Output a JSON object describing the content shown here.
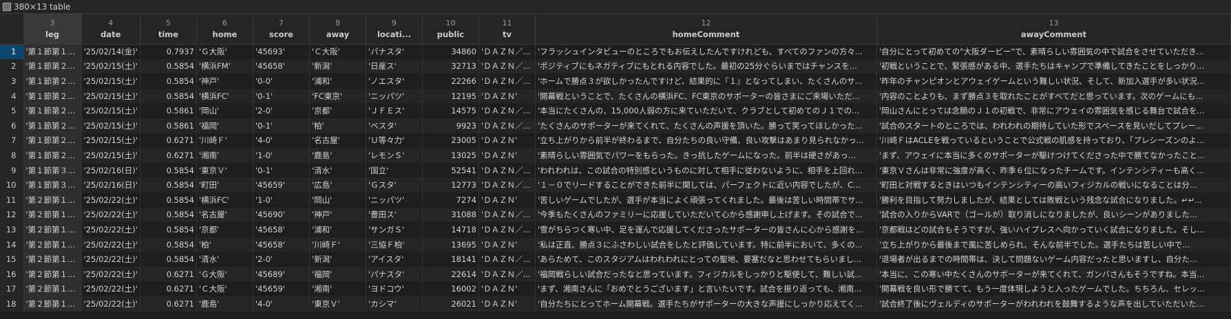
{
  "title": "380×13 table",
  "columns": [
    {
      "num": "3",
      "name": "leg"
    },
    {
      "num": "4",
      "name": "date"
    },
    {
      "num": "5",
      "name": "time"
    },
    {
      "num": "6",
      "name": "home"
    },
    {
      "num": "7",
      "name": "score"
    },
    {
      "num": "8",
      "name": "away"
    },
    {
      "num": "9",
      "name": "locati..."
    },
    {
      "num": "10",
      "name": "public"
    },
    {
      "num": "11",
      "name": "tv"
    },
    {
      "num": "12",
      "name": "homeComment"
    },
    {
      "num": "13",
      "name": "awayComment"
    }
  ],
  "rows": [
    {
      "n": "1",
      "leg": "'第１節第１...",
      "date": "'25/02/14(金)'",
      "time": "0.7937",
      "home": "'Ｇ大阪'",
      "score": "'45693'",
      "away": "'Ｃ大阪'",
      "loc": "'パナスタ'",
      "public": "34860",
      "tv": "'ＤＡＺＮ／...",
      "hc": "'フラッシュインタビューのところでもお伝えしたんですけれども、すべてのファンの方々...",
      "ac": "'自分にとって初めての\"大阪ダービー\"で、素晴らしい雰囲気の中で試合をさせていただき..."
    },
    {
      "n": "2",
      "leg": "'第１節第２...",
      "date": "'25/02/15(土)'",
      "time": "0.5854",
      "home": "'横浜FM'",
      "score": "'45658'",
      "away": "'新潟'",
      "loc": "'日産ス'",
      "public": "32713",
      "tv": "'ＤＡＺＮ／...",
      "hc": "'ポジティブにもネガティブにもとれる内容でした。最初の25分ぐらいまではチャンスを...",
      "ac": "'初戦ということで、緊張感がある中、選手たちはキャンプで準備してきたことをしっかり..."
    },
    {
      "n": "3",
      "leg": "'第１節第２...",
      "date": "'25/02/15(土)'",
      "time": "0.5854",
      "home": "'神戸'",
      "score": "'0-0'",
      "away": "'浦和'",
      "loc": "'ノエスタ'",
      "public": "22266",
      "tv": "'ＤＡＺＮ／...",
      "hc": "'ホームで勝点３が欲しかったんですけど、結果的に『１』となってしまい、たくさんのサ...",
      "ac": "'昨年のチャンピオンとアウェイゲームという難しい状況、そして、新加入選手が多い状況..."
    },
    {
      "n": "4",
      "leg": "'第１節第２...",
      "date": "'25/02/15(土)'",
      "time": "0.5854",
      "home": "'横浜FC'",
      "score": "'0-1'",
      "away": "'FC東京'",
      "loc": "'ニッパツ'",
      "public": "12195",
      "tv": "'ＤＡＺＮ'",
      "hc": "'開幕戦ということで、たくさんの横浜FC、FC東京のサポーターの皆さまにご来場いただ...",
      "ac": "'内容のことよりも、まず勝点３を取れたことがすべてだと思っています。次のゲームにも..."
    },
    {
      "n": "5",
      "leg": "'第１節第２...",
      "date": "'25/02/15(土)'",
      "time": "0.5861",
      "home": "'岡山'",
      "score": "'2-0'",
      "away": "'京都'",
      "loc": "'ＪＦＥス'",
      "public": "14575",
      "tv": "'ＤＡＺＮ／...",
      "hc": "'本当にたくさんの、15,000人弱の方に来ていただいて、クラブとして初めてのＪ１での...",
      "ac": "'岡山さんにとっては念願のＪ１の初戦で、非常にアウェイの雰囲気を感じる舞台で試合を..."
    },
    {
      "n": "6",
      "leg": "'第１節第２...",
      "date": "'25/02/15(土)'",
      "time": "0.5861",
      "home": "'福岡'",
      "score": "'0-1'",
      "away": "'柏'",
      "loc": "'ベスタ'",
      "public": "9923",
      "tv": "'ＤＡＺＮ／...",
      "hc": "'たくさんのサポーターが来てくれて、たくさんの声援を頂いた。勝って笑ってほしかった...",
      "ac": "'試合のスタートのところでは、われわれの期待していた形でスペースを見いだしてプレー..."
    },
    {
      "n": "7",
      "leg": "'第１節第２...",
      "date": "'25/02/15(土)'",
      "time": "0.6271",
      "home": "'川崎Ｆ'",
      "score": "'4-0'",
      "away": "'名古屋'",
      "loc": "'Ｕ等々力'",
      "public": "23005",
      "tv": "'ＤＡＺＮ'",
      "hc": "'立ち上がりから前半が終わるまで、自分たちの良い守備、良い攻撃はあまり見られなかっ...",
      "ac": "'川崎ＦはACLEを戦っているということで公式戦の肌感を持っており、「プレシーズンのよ..."
    },
    {
      "n": "8",
      "leg": "'第１節第２...",
      "date": "'25/02/15(土)'",
      "time": "0.6271",
      "home": "'湘南'",
      "score": "'1-0'",
      "away": "'鹿島'",
      "loc": "'レモンＳ'",
      "public": "13025",
      "tv": "'ＤＡＺＮ'",
      "hc": "'素晴らしい雰囲気でパワーをもらった。きっ抗したゲームになった。前半は硬さがあっ...",
      "ac": "'まず、アウェイに本当に多くのサポーターが駆けつけてくださった中で勝てなかったこと..."
    },
    {
      "n": "9",
      "leg": "'第１節第３...",
      "date": "'25/02/16(日)'",
      "time": "0.5854",
      "home": "'東京Ｖ'",
      "score": "'0-1'",
      "away": "'清水'",
      "loc": "'国立'",
      "public": "52541",
      "tv": "'ＤＡＺＮ／...",
      "hc": "'われわれは、この試合の特別感というものに対して相手に従わないように、相手を上回れ...",
      "ac": "'東京Ｖさんは非常に強度が高く、昨季６位になったチームです。インテンシティーも高く..."
    },
    {
      "n": "10",
      "leg": "'第１節第３...",
      "date": "'25/02/16(日)'",
      "time": "0.5854",
      "home": "'町田'",
      "score": "'45659'",
      "away": "'広島'",
      "loc": "'Ｇスタ'",
      "public": "12773",
      "tv": "'ＤＡＺＮ／...",
      "hc": "'１－０でリードすることができた前半に関しては、パーフェクトに近い内容でしたが、C...",
      "ac": "'町田と対戦するときはいつもインテンシティーの高いフィジカルの戦いになることは分..."
    },
    {
      "n": "11",
      "leg": "'第２節第１...",
      "date": "'25/02/22(土)'",
      "time": "0.5854",
      "home": "'横浜FC'",
      "score": "'1-0'",
      "away": "'岡山'",
      "loc": "'ニッパツ'",
      "public": "7274",
      "tv": "'ＤＡＺＮ'",
      "hc": "'苦しいゲームでしたが、選手が本当によく頑張ってくれました。最後は苦しい時間帯でサ...",
      "ac": "'勝利を目指して努力しましたが、結果としては敗戦という残念な試合になりました。↵↵..."
    },
    {
      "n": "12",
      "leg": "'第２節第１...",
      "date": "'25/02/22(土)'",
      "time": "0.5854",
      "home": "'名古屋'",
      "score": "'45690'",
      "away": "'神戸'",
      "loc": "'豊田ス'",
      "public": "31088",
      "tv": "'ＤＡＺＮ／...",
      "hc": "'今季もたくさんのファミリーに応援していただいて心から感謝申し上げます。その試合で...",
      "ac": "'試合の入りからVARで（ゴールが）取り消しになりましたが、良いシーンがありました..."
    },
    {
      "n": "13",
      "leg": "'第２節第１...",
      "date": "'25/02/22(土)'",
      "time": "0.5854",
      "home": "'京都'",
      "score": "'45658'",
      "away": "'浦和'",
      "loc": "'サンガＳ'",
      "public": "14718",
      "tv": "'ＤＡＺＮ／...",
      "hc": "'雪がちらつく寒い中、足を運んで応援してくださったサポーターの皆さんに心から感謝を...",
      "ac": "'京都戦はどの試合もそうですが、強いハイプレスへ向かっていく試合になりました。そし..."
    },
    {
      "n": "14",
      "leg": "'第２節第１...",
      "date": "'25/02/22(土)'",
      "time": "0.5854",
      "home": "'柏'",
      "score": "'45658'",
      "away": "'川崎Ｆ'",
      "loc": "'三協Ｆ柏'",
      "public": "13695",
      "tv": "'ＤＡＺＮ'",
      "hc": "'私は正直、勝点３にふさわしい試合をしたと評価しています。特に前半において、多くの...",
      "ac": "'立ち上がりから最後まで風に苦しめられ、そんな前半でした。選手たちは苦しい中で..."
    },
    {
      "n": "15",
      "leg": "'第２節第１...",
      "date": "'25/02/22(土)'",
      "time": "0.5854",
      "home": "'清水'",
      "score": "'2-0'",
      "away": "'新潟'",
      "loc": "'アイスタ'",
      "public": "18141",
      "tv": "'ＤＡＺＮ／...",
      "hc": "'あらためて、このスタジアムはわれわれにとっての聖地、要塞だなと思わせてもらいまし...",
      "ac": "'退場者が出るまでの時間帯は、決して問題ないゲーム内容だったと思いますし、自分た..."
    },
    {
      "n": "16",
      "leg": "'第２節第１...",
      "date": "'25/02/22(土)'",
      "time": "0.6271",
      "home": "'Ｇ大阪'",
      "score": "'45689'",
      "away": "'福岡'",
      "loc": "'パナスタ'",
      "public": "22614",
      "tv": "'ＤＡＺＮ／...",
      "hc": "'福岡戦らしい試合だったなと思っています。フィジカルをしっかりと駆使して、難しい試...",
      "ac": "'本当に、この寒い中たくさんのサポーターが来てくれて、ガンバさんもそうですね。本当..."
    },
    {
      "n": "17",
      "leg": "'第２節第１...",
      "date": "'25/02/22(土)'",
      "time": "0.6271",
      "home": "'Ｃ大阪'",
      "score": "'45659'",
      "away": "'湘南'",
      "loc": "'ヨドコウ'",
      "public": "16002",
      "tv": "'ＤＡＺＮ'",
      "hc": "'まず、湘南さんに「おめでとうございます」と言いたいです。試合を振り返っても、湘南...",
      "ac": "'開幕戦を良い形で勝てて、もう一度体現しようと入ったゲームでした。ちちろん、セレッ..."
    },
    {
      "n": "18",
      "leg": "'第２節第１...",
      "date": "'25/02/22(土)'",
      "time": "0.6271",
      "home": "'鹿島'",
      "score": "'4-0'",
      "away": "'東京Ｖ'",
      "loc": "'カシマ'",
      "public": "26021",
      "tv": "'ＤＡＺＮ'",
      "hc": "'自分たちにとってホーム開幕戦。選手たちがサポーターの大きな声援にしっかり応えてく...",
      "ac": "'試合終了後にヴェルディのサポーターがわれわれを鼓舞するような声を出していただいた..."
    }
  ]
}
